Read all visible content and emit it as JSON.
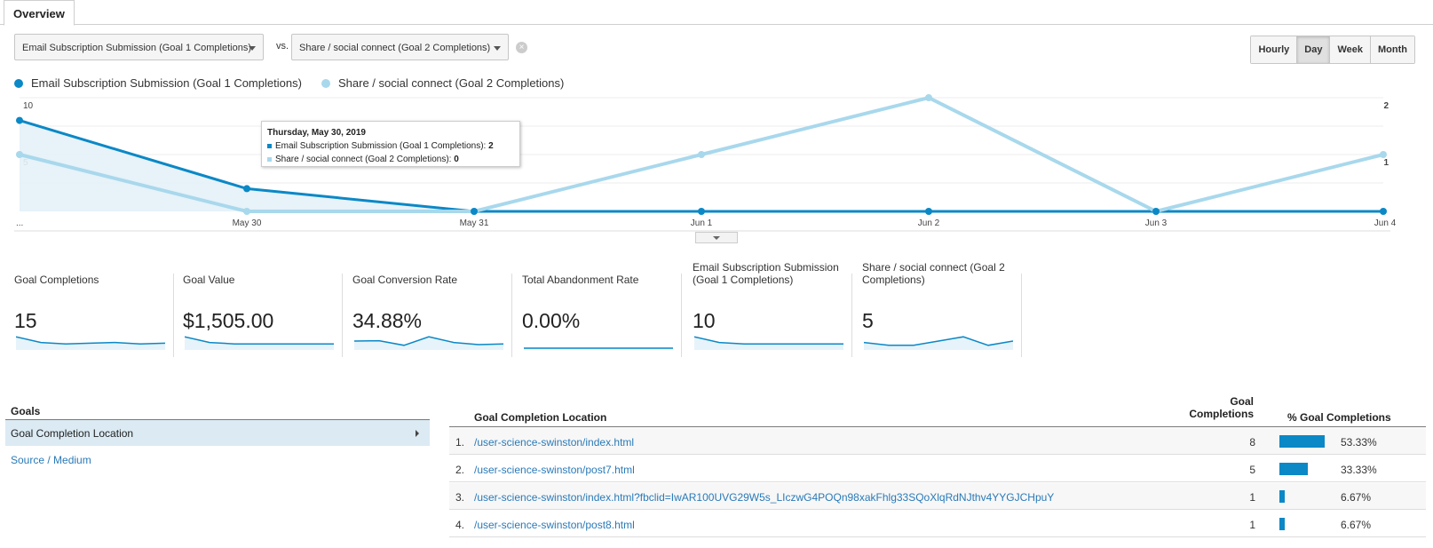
{
  "tab": {
    "label": "Overview"
  },
  "compare": {
    "metric1": "Email Subscription Submission (Goal 1 Completions)",
    "vs": "vs.",
    "metric2": "Share / social connect (Goal 2 Completions)",
    "clear_icon": "close-circle-icon"
  },
  "periods": {
    "hourly": "Hourly",
    "day": "Day",
    "week": "Week",
    "month": "Month",
    "selected": "Day"
  },
  "legend": {
    "series1": "Email Subscription Submission (Goal 1 Completions)",
    "series2": "Share / social connect (Goal 2 Completions)"
  },
  "colors": {
    "series1": "#0b88c6",
    "series2": "#a8d8ec",
    "link": "#2a7ab8"
  },
  "tooltip": {
    "title": "Thursday, May 30, 2019",
    "line1_label": "Email Subscription Submission (Goal 1 Completions):",
    "line1_value": "2",
    "line2_label": "Share / social connect (Goal 2 Completions):",
    "line2_value": "0"
  },
  "chart_data": {
    "type": "line",
    "x": [
      "...",
      "May 30",
      "May 31",
      "Jun 1",
      "Jun 2",
      "Jun 3",
      "Jun 4"
    ],
    "y_left_ticks": [
      "10",
      "5"
    ],
    "y_right_ticks": [
      "2",
      "1"
    ],
    "y_left_max": 10,
    "y_right_max": 2,
    "series": [
      {
        "name": "Email Subscription Submission (Goal 1 Completions)",
        "axis": "left",
        "area": true,
        "values": [
          8,
          2,
          0,
          0,
          0,
          0,
          0
        ]
      },
      {
        "name": "Share / social connect (Goal 2 Completions)",
        "axis": "right",
        "area": false,
        "values": [
          1,
          0,
          0,
          1,
          2,
          0,
          1
        ]
      }
    ],
    "grid": true
  },
  "metrics": [
    {
      "label": "Goal Completions",
      "value": "15",
      "spark": [
        8,
        4,
        3,
        3.5,
        4,
        3,
        3.5
      ]
    },
    {
      "label": "Goal Value",
      "value": "$1,505.00",
      "spark": [
        8,
        4,
        3,
        3,
        3,
        3,
        3
      ]
    },
    {
      "label": "Goal Conversion Rate",
      "value": "34.88%",
      "spark": [
        5,
        5.2,
        2,
        8,
        4,
        2.5,
        3
      ]
    },
    {
      "label": "Total Abandonment Rate",
      "value": "0.00%",
      "spark": [
        0,
        0,
        0,
        0,
        0,
        0,
        0
      ]
    },
    {
      "label": "Email Subscription Submission (Goal 1 Completions)",
      "value": "10",
      "spark": [
        8,
        4,
        3,
        3,
        3,
        3,
        3
      ]
    },
    {
      "label": "Share / social connect (Goal 2 Completions)",
      "value": "5",
      "spark": [
        4,
        2,
        2,
        5,
        8,
        2,
        5
      ]
    }
  ],
  "goals": {
    "heading": "Goals",
    "selected": "Goal Completion Location",
    "link": "Source / Medium"
  },
  "table": {
    "col_location": "Goal Completion Location",
    "col_completions_1": "Goal",
    "col_completions_2": "Completions",
    "col_percent": "% Goal Completions",
    "rows": [
      {
        "idx": "1.",
        "url": "/user-science-swinston/index.html",
        "count": "8",
        "pct": "53.33%",
        "share": 0.5333
      },
      {
        "idx": "2.",
        "url": "/user-science-swinston/post7.html",
        "count": "5",
        "pct": "33.33%",
        "share": 0.3333
      },
      {
        "idx": "3.",
        "url": "/user-science-swinston/index.html?fbclid=IwAR100UVG29W5s_LIczwG4POQn98xakFhlg33SQoXlqRdNJthv4YYGJCHpuY",
        "count": "1",
        "pct": "6.67%",
        "share": 0.0667
      },
      {
        "idx": "4.",
        "url": "/user-science-swinston/post8.html",
        "count": "1",
        "pct": "6.67%",
        "share": 0.0667
      }
    ]
  }
}
